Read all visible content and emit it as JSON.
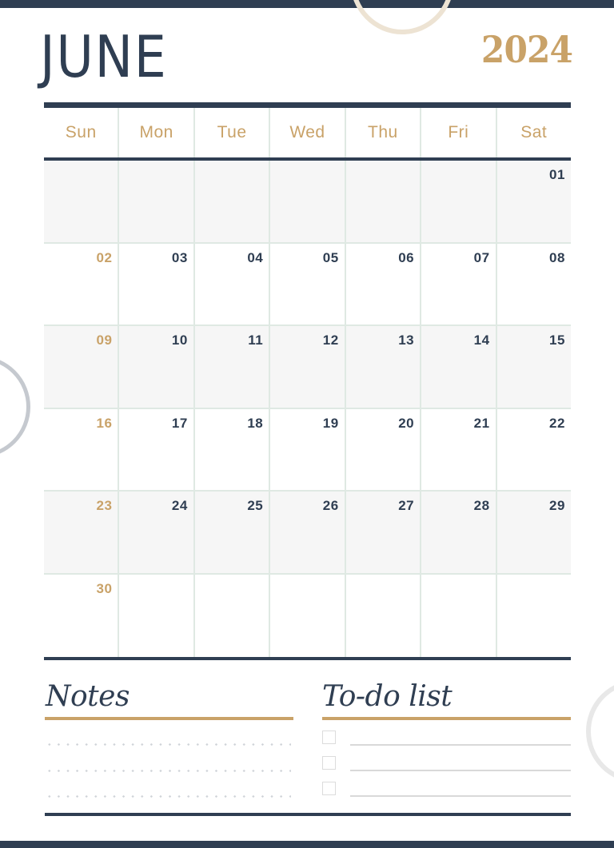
{
  "header": {
    "month": "JUNE",
    "year": "2024"
  },
  "colors": {
    "navy": "#2f3e52",
    "gold": "#c9a268",
    "grid_line": "#dfe9e3",
    "shaded_row": "#f6f6f6"
  },
  "weekdays": [
    "Sun",
    "Mon",
    "Tue",
    "Wed",
    "Thu",
    "Fri",
    "Sat"
  ],
  "weeks": [
    [
      "",
      "",
      "",
      "",
      "",
      "",
      "01"
    ],
    [
      "02",
      "03",
      "04",
      "05",
      "06",
      "07",
      "08"
    ],
    [
      "09",
      "10",
      "11",
      "12",
      "13",
      "14",
      "15"
    ],
    [
      "16",
      "17",
      "18",
      "19",
      "20",
      "21",
      "22"
    ],
    [
      "23",
      "24",
      "25",
      "26",
      "27",
      "28",
      "29"
    ],
    [
      "30",
      "",
      "",
      "",
      "",
      "",
      ""
    ]
  ],
  "notes": {
    "title": "Notes",
    "line_count": 3
  },
  "todo": {
    "title": "To-do list",
    "items": [
      {
        "checked": false,
        "text": ""
      },
      {
        "checked": false,
        "text": ""
      },
      {
        "checked": false,
        "text": ""
      }
    ]
  }
}
